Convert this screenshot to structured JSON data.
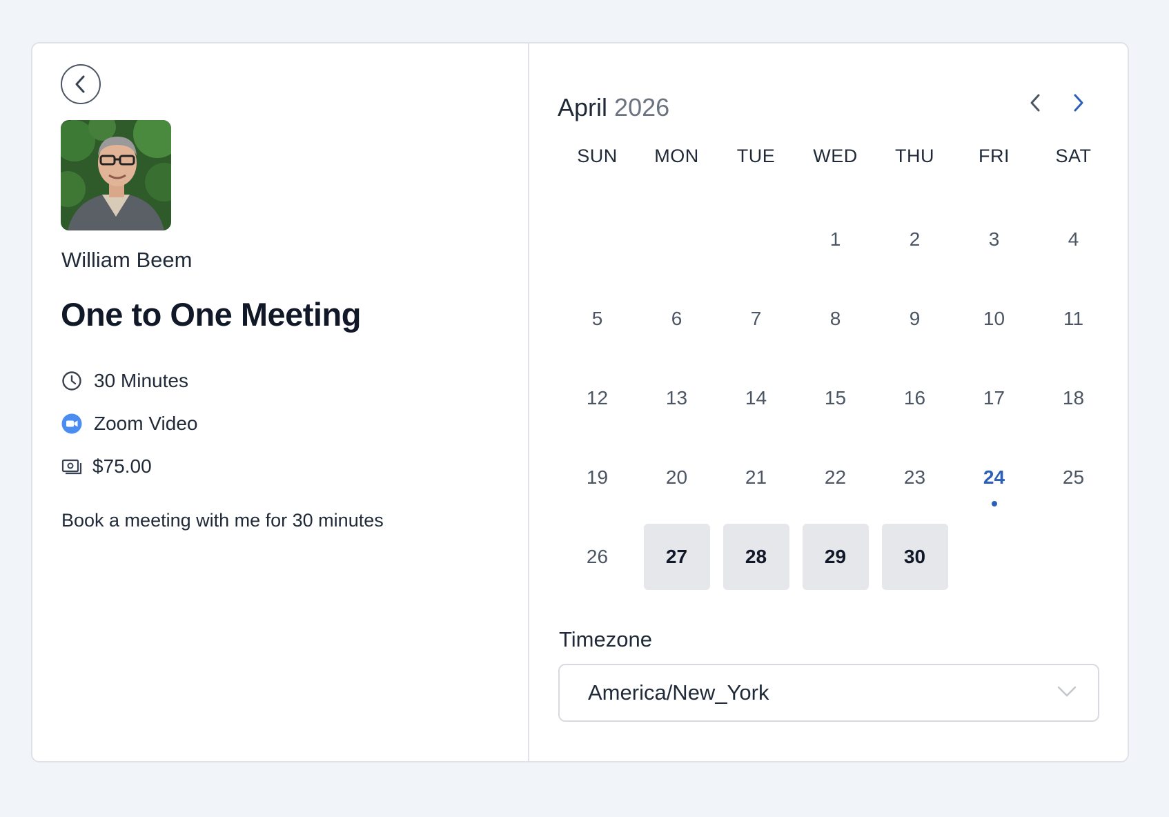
{
  "host": {
    "name": "William Beem"
  },
  "event": {
    "title": "One to One Meeting",
    "duration": "30 Minutes",
    "location": "Zoom Video",
    "price": "$75.00",
    "description": "Book a meeting with me for 30 minutes"
  },
  "calendar": {
    "month": "April",
    "year": "2026",
    "weekdays": [
      "SUN",
      "MON",
      "TUE",
      "WED",
      "THU",
      "FRI",
      "SAT"
    ],
    "leading_blanks": 3,
    "days_in_month": 30,
    "today": 24,
    "available_days": [
      27,
      28,
      29,
      30
    ]
  },
  "timezone": {
    "label": "Timezone",
    "value": "America/New_York"
  },
  "colors": {
    "accent": "#2b5fb8",
    "zoom_blue": "#4a8cf0",
    "available_bg": "#e5e7eb",
    "page_bg": "#f1f4f8"
  },
  "icons": {
    "back": "chevron-left-icon",
    "duration": "clock-icon",
    "location": "video-camera-icon",
    "price": "money-icon",
    "prev_month": "chevron-left-icon",
    "next_month": "chevron-right-icon",
    "select": "chevron-down-icon"
  }
}
